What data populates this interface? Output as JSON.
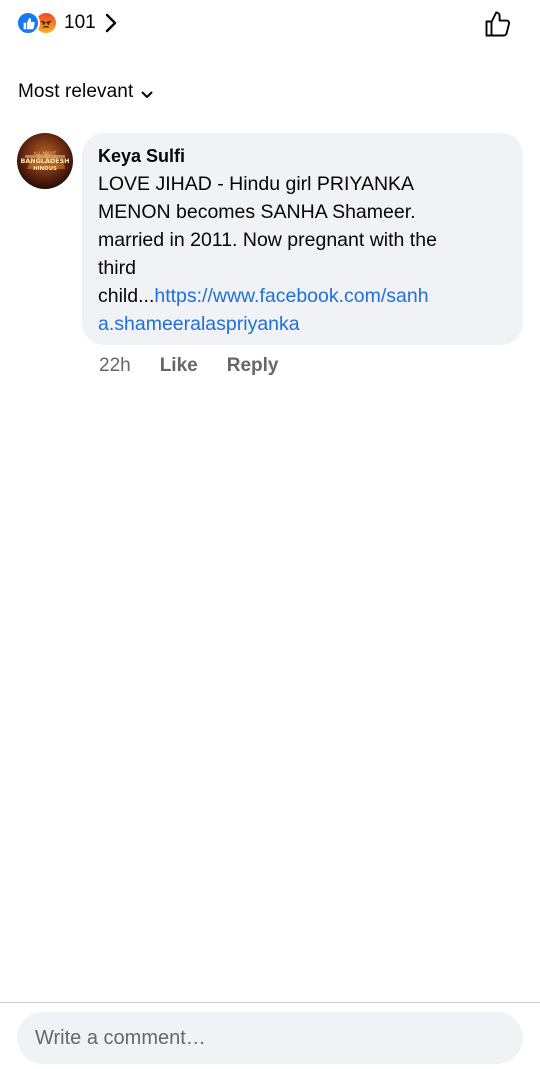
{
  "reactions": {
    "types": [
      "like-icon",
      "angry-icon"
    ],
    "count": "101",
    "like_color": "#1877f2",
    "angry_color": "#f0442a"
  },
  "sort": {
    "label": "Most relevant"
  },
  "comment": {
    "author": "Keya Sulfi",
    "avatar_lines": [
      "ALL ABOUT",
      "BANGLADESH",
      "HINDUS"
    ],
    "text_lines": [
      "LOVE JIHAD - Hindu girl PRIYANKA",
      "MENON becomes SANHA Shameer.",
      "married in 2011. Now pregnant with the",
      "third"
    ],
    "last_line_prefix": "child...",
    "link_line1": "https://www.facebook.com/sanh",
    "link_line2": "a.shameeralaspriyanka",
    "time": "22h",
    "like_label": "Like",
    "reply_label": "Reply"
  },
  "composer": {
    "placeholder": "Write a comment…"
  },
  "colors": {
    "link": "#216fdb",
    "secondary_text": "#65676b",
    "bubble_bg": "#f0f2f5"
  }
}
